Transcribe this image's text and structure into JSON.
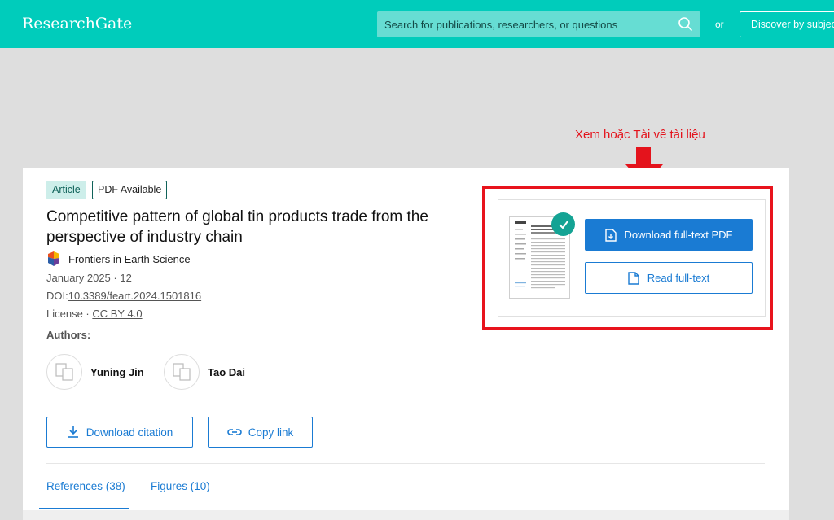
{
  "header": {
    "logo": "ResearchGate",
    "search_placeholder": "Search for publications, researchers, or questions",
    "or_text": "or",
    "discover_label": "Discover by subject area"
  },
  "annotation": {
    "text": "Xem hoặc Tài về tài liệu"
  },
  "article": {
    "badges": [
      "Article",
      "PDF Available"
    ],
    "title": "Competitive pattern of global tin products trade from the perspective of industry chain",
    "journal": "Frontiers in Earth Science",
    "date_line": "January 2025 · 12",
    "doi_label": "DOI:",
    "doi_value": "10.3389/feart.2024.1501816",
    "license_label": "License · ",
    "license_value": "CC BY 4.0",
    "authors_label": "Authors:",
    "authors": [
      "Yuning Jin",
      "Tao Dai"
    ]
  },
  "actions": {
    "download_citation": "Download citation",
    "copy_link": "Copy link",
    "download_pdf": "Download full-text PDF",
    "read_fulltext": "Read full-text"
  },
  "tabs": [
    "References (38)",
    "Figures (10)"
  ],
  "colors": {
    "header_bg": "#00ccbb",
    "primary_blue": "#1a7bd3",
    "annotation_red": "#e8131c",
    "check_green": "#14a394"
  }
}
